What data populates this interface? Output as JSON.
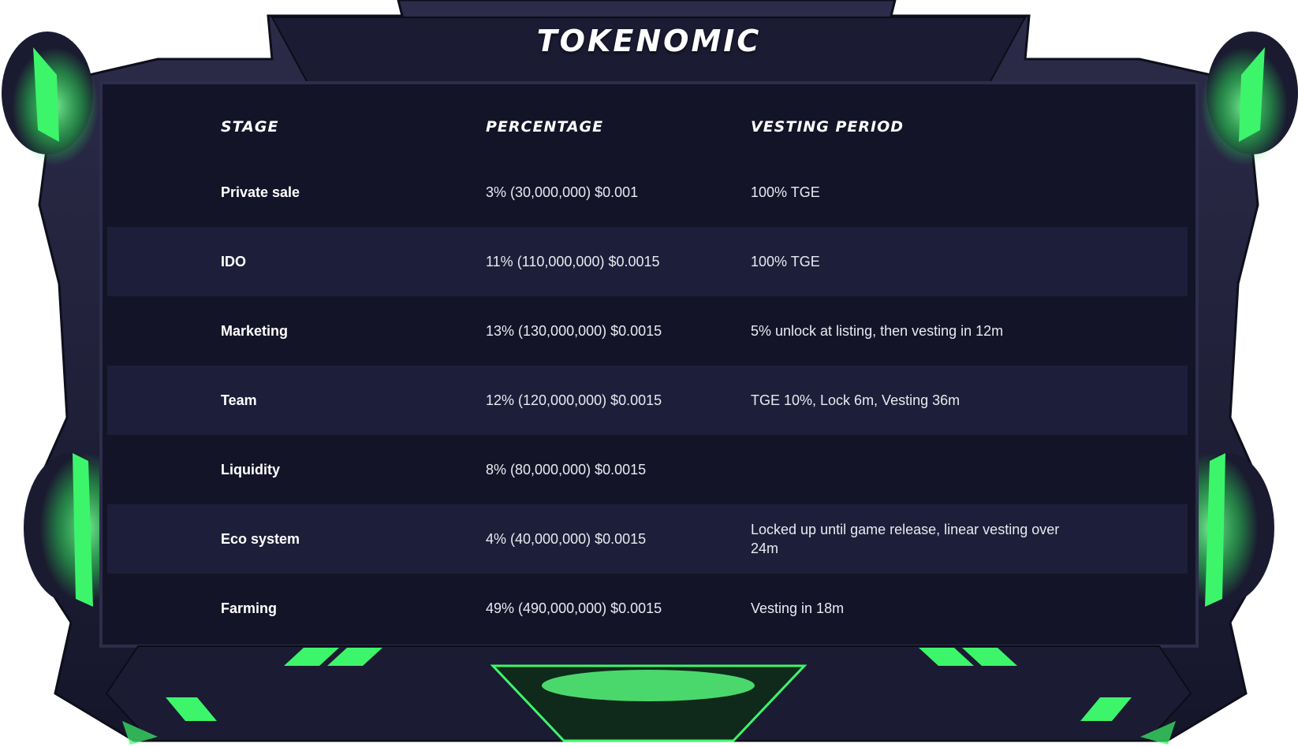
{
  "title": "TOKENOMIC",
  "headers": {
    "stage": "STAGE",
    "percentage": "PERCENTAGE",
    "vesting": "VESTING PERIOD"
  },
  "rows": [
    {
      "stage": "Private sale",
      "percentage": "3% (30,000,000) $0.001",
      "vesting": "100% TGE"
    },
    {
      "stage": "IDO",
      "percentage": "11% (110,000,000) $0.0015",
      "vesting": "100% TGE"
    },
    {
      "stage": "Marketing",
      "percentage": "13% (130,000,000) $0.0015",
      "vesting": "5% unlock at listing, then vesting in 12m"
    },
    {
      "stage": "Team",
      "percentage": "12% (120,000,000) $0.0015",
      "vesting": "TGE 10%, Lock 6m, Vesting 36m"
    },
    {
      "stage": "Liquidity",
      "percentage": "8% (80,000,000) $0.0015",
      "vesting": ""
    },
    {
      "stage": "Eco system",
      "percentage": "4% (40,000,000) $0.0015",
      "vesting": "Locked up until game release, linear vesting over 24m"
    },
    {
      "stage": "Farming",
      "percentage": "49% (490,000,000) $0.0015",
      "vesting": "Vesting in 18m"
    }
  ],
  "colors": {
    "accent": "#3df56b",
    "frame": "#23233d",
    "panel": "#141428",
    "panel_alt": "#1d1e39"
  }
}
